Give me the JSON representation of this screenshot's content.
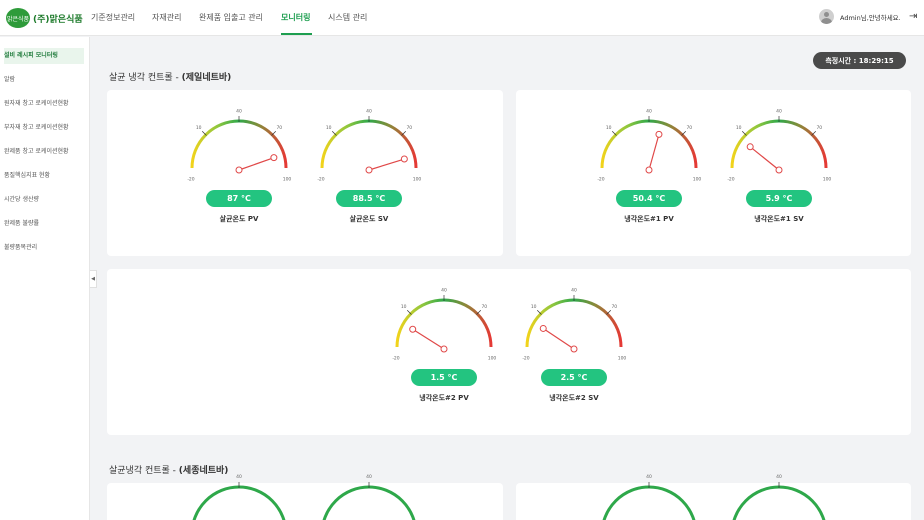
{
  "app": {
    "logo_mark": "맑은식품",
    "logo_text": "(주)맑은식품"
  },
  "nav": {
    "items": [
      "기준정보관리",
      "자재관리",
      "완제품 입출고 관리",
      "모니터링",
      "시스템 관리"
    ],
    "active": "모니터링"
  },
  "user": {
    "greeting": "Admin님,안녕하세요."
  },
  "sidebar": {
    "items": [
      "설비 레시피 모니터링",
      "알람",
      "원자재 창고 로케이션현황",
      "부자재 창고 로케이션현황",
      "완제품 창고 로케이션현황",
      "품질핵심지표 현황",
      "시간당 생산량",
      "완제품 불량률",
      "불량품목관리"
    ],
    "active": "설비 레시피 모니터링"
  },
  "measure_time": "측정시간 : 18:29:15",
  "sections": [
    {
      "title_prefix": "살균 냉각 컨트롤 - ",
      "title_bold": "(제일네트바)"
    },
    {
      "title_prefix": "살균냉각 컨트롤 - ",
      "title_bold": "(세종네트바)"
    }
  ],
  "gauge_ticks": {
    "min": "-20",
    "t1": "10",
    "mid": "40",
    "t3": "70",
    "max": "100"
  },
  "colors": {
    "gauge_green": "#23c480",
    "needle": "#e04848"
  },
  "gauges": [
    {
      "label": "살균온도 PV",
      "display": "87 °C",
      "value": 87
    },
    {
      "label": "살균온도 SV",
      "display": "88.5 °C",
      "value": 88.5
    },
    {
      "label": "냉각온도#1 PV",
      "display": "50.4 °C",
      "value": 50.4
    },
    {
      "label": "냉각온도#1 SV",
      "display": "5.9 °C",
      "value": 5.9
    },
    {
      "label": "냉각온도#2 PV",
      "display": "1.5 °C",
      "value": 1.5
    },
    {
      "label": "냉각온도#2 SV",
      "display": "2.5 °C",
      "value": 2.5
    }
  ]
}
